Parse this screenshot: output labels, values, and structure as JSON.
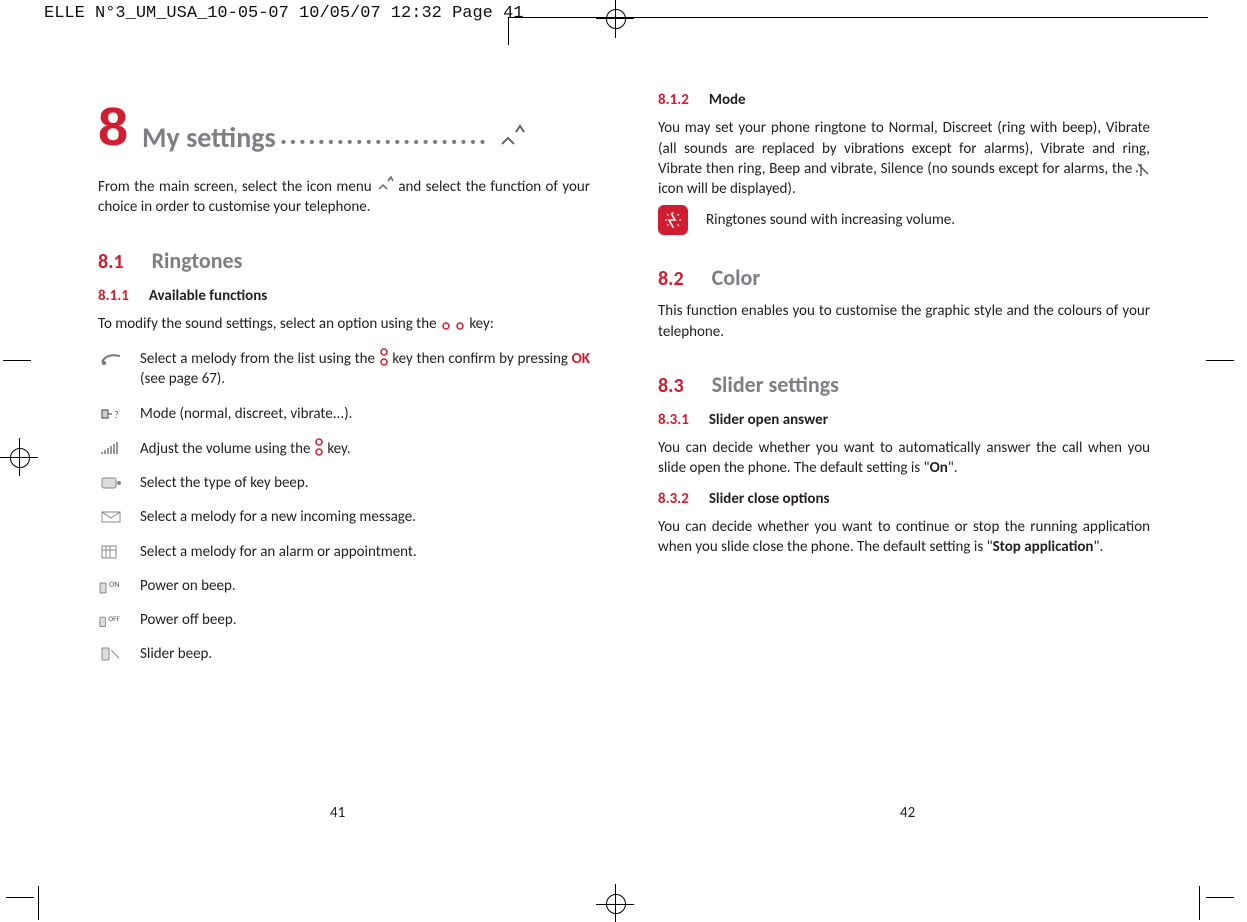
{
  "slug": "ELLE N°3_UM_USA_10-05-07  10/05/07  12:32  Page 41",
  "chapter": {
    "num": "8",
    "title": "My settings",
    "dots": "......................"
  },
  "intro_pre": "From the main screen, select the icon menu ",
  "intro_post": " and select the function of your choice in order to customise your telephone.",
  "s81": {
    "num": "8.1",
    "title": "Ringtones"
  },
  "s811": {
    "num": "8.1.1",
    "title": "Available functions"
  },
  "s811_intro_pre": "To modify the sound settings, select an option using the ",
  "s811_intro_post": " key:",
  "items": {
    "melody_pre": "Select a melody from the list using the ",
    "melody_mid": " key then confirm by pressing ",
    "ok": "OK",
    "melody_post": " (see page 67).",
    "mode": "Mode (normal, discreet, vibrate...).",
    "volume_pre": "Adjust the volume using the ",
    "volume_post": " key.",
    "keybeep": "Select the type of key beep.",
    "msg": "Select a melody for a new incoming message.",
    "alarm": "Select a melody for an alarm or appointment.",
    "poweron": "Power on beep.",
    "poweroff": "Power off beep.",
    "slider": "Slider beep."
  },
  "s812": {
    "num": "8.1.2",
    "title": "Mode"
  },
  "s812_para_pre": "You may set your phone ringtone to Normal, Discreet (ring with beep), Vibrate (all sounds are replaced by vibrations except for alarms), Vibrate and ring, Vibrate then ring, Beep and vibrate, Silence (no sounds except for alarms, the ",
  "s812_para_post": " icon will be displayed).",
  "tip": "Ringtones sound with increasing volume.",
  "s82": {
    "num": "8.2",
    "title": "Color"
  },
  "s82_para": "This function enables you to customise the graphic style and the colours of your telephone.",
  "s83": {
    "num": "8.3",
    "title": "Slider settings"
  },
  "s831": {
    "num": "8.3.1",
    "title": "Slider open answer"
  },
  "s831_para_pre": "You can decide whether you want to automatically answer the call when you slide open the phone. The default setting is \"",
  "s831_bold": "On",
  "s831_para_post": "\".",
  "s832": {
    "num": "8.3.2",
    "title": "Slider close options"
  },
  "s832_para_pre": "You can decide whether you want to continue or stop the running application when you slide close the phone. The default setting is \"",
  "s832_bold": "Stop application",
  "s832_para_post": "\".",
  "pages": {
    "left": "41",
    "right": "42"
  }
}
